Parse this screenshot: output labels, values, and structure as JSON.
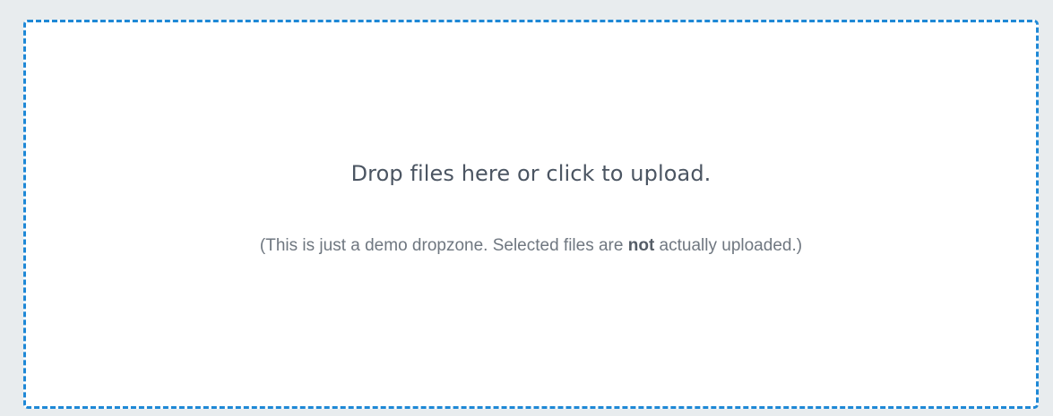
{
  "dropzone": {
    "title": "Drop files here or click to upload.",
    "note_before": "(This is just a demo dropzone. Selected files are ",
    "note_emphasis": "not",
    "note_after": " actually uploaded.)",
    "accent_color": "#1e88d6"
  }
}
